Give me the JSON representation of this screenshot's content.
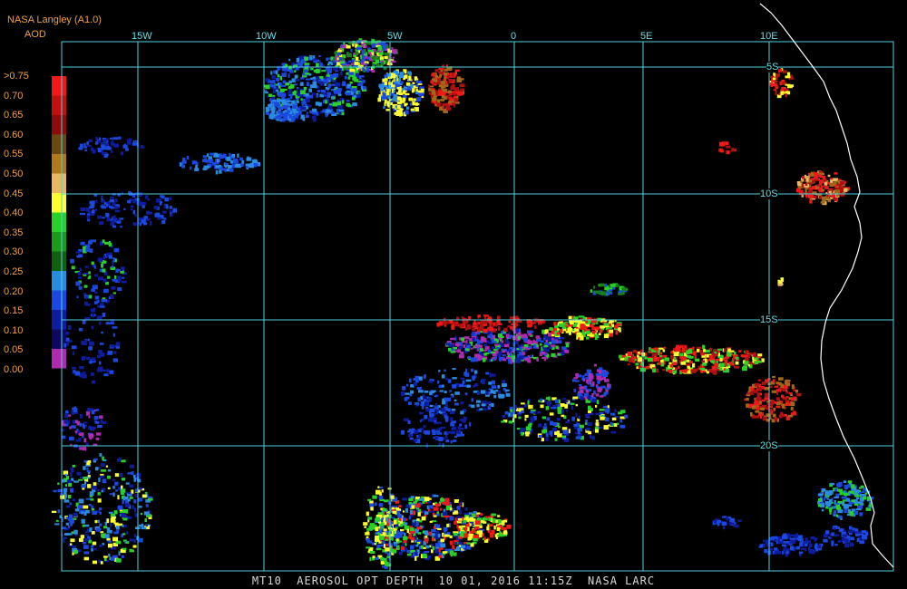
{
  "header": {
    "source": "NASA Langley (A1.0)",
    "product": "AOD"
  },
  "legend": {
    "labels": [
      ">0.75",
      "0.70",
      "0.65",
      "0.60",
      "0.55",
      "0.50",
      "0.45",
      "0.40",
      "0.35",
      "0.30",
      "0.25",
      "0.20",
      "0.15",
      "0.10",
      "0.05",
      "0.00"
    ],
    "colors": [
      "#f01818",
      "#c01010",
      "#8c0c0c",
      "#6a4a12",
      "#b07a1a",
      "#e8b860",
      "#ffff30",
      "#28d028",
      "#1c9a1c",
      "#106010",
      "#2a8ce0",
      "#1a48e0",
      "#0e1ca0",
      "#0c0a60",
      "#b02ab0"
    ]
  },
  "grid": {
    "longitudes": [
      "15W",
      "10W",
      "5W",
      "0",
      "5E",
      "10E"
    ],
    "latitudes": [
      "5S",
      "10S",
      "15S",
      "20S"
    ],
    "line_color": "#4fd0e0"
  },
  "footer": {
    "text": "MT10  AEROSOL OPT DEPTH  10 01, 2016 11:15Z  NASA LARC"
  },
  "colors": {
    "coastline": "#ffffff",
    "background": "#000000"
  }
}
